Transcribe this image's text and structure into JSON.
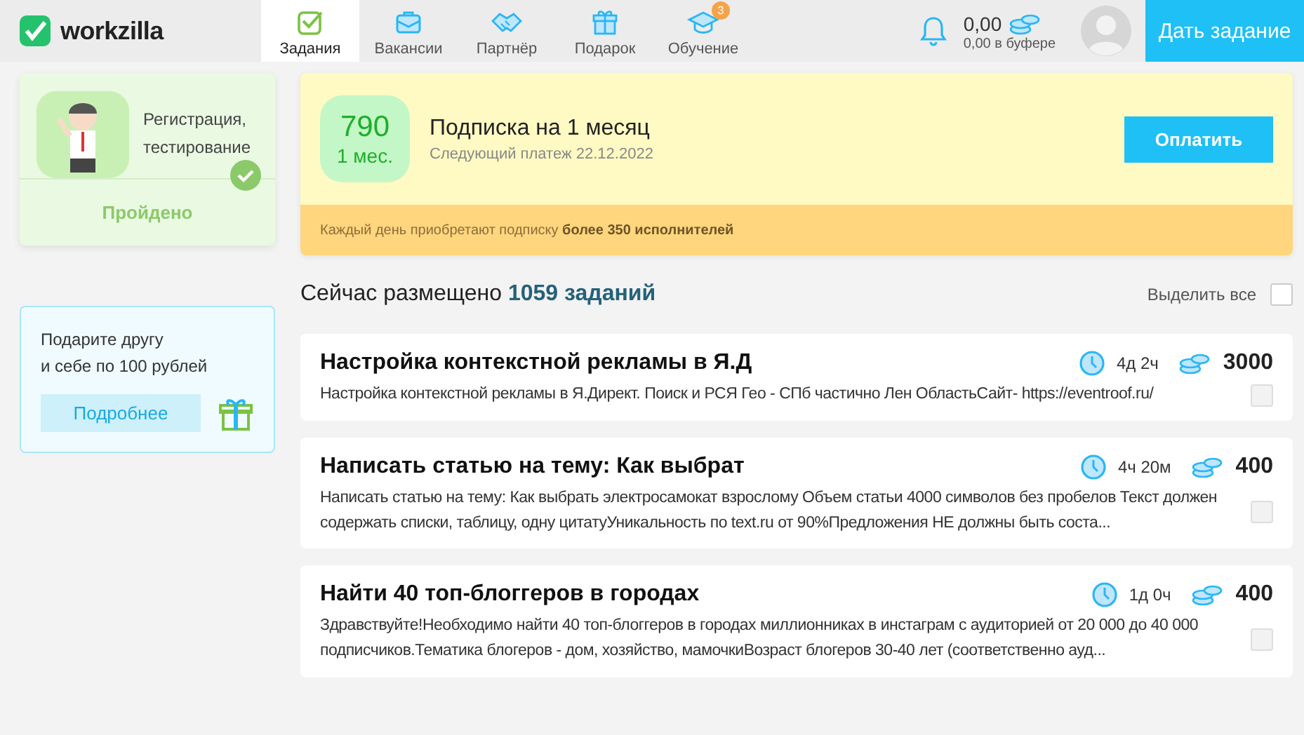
{
  "header": {
    "logo": "workzilla",
    "nav": [
      {
        "label": "Задания",
        "selected": true
      },
      {
        "label": "Вакансии",
        "selected": false
      },
      {
        "label": "Партнёр",
        "selected": false
      },
      {
        "label": "Подарок",
        "selected": false
      },
      {
        "label": "Обучение",
        "selected": false,
        "badge": "3"
      }
    ],
    "balance": "0,00",
    "buffer": "0,00 в буфере",
    "post_button": "Дать задание"
  },
  "sidebar": {
    "onboarding": {
      "text": "Регистрация,\nтестирование",
      "status": "Пройдено",
      "passed": true
    },
    "referral": {
      "text": "Подарите другу\nи себе по 100 рублей",
      "button": "Подробнее"
    }
  },
  "subscription": {
    "price": "790",
    "period": "1 мес.",
    "title": "Подписка на 1 месяц",
    "next_payment": "Следующий платеж 22.12.2022",
    "button": "Оплатить",
    "note": "Каждый день приобретают подписку **более 350 исполнителей**"
  },
  "listing": {
    "heading": "Сейчас размещено **1059 заданий**",
    "select_all": {
      "label": "Выделить все",
      "checked": false
    }
  },
  "tasks": [
    {
      "title": "Настройка контекстной рекламы в Я.Д",
      "time": "4д 2ч",
      "price": "3000",
      "description": "Настройка контекстной рекламы в Я.Директ. Поиск и РСЯ Гео - СПб частично Лен ОбластьСайт- https://eventroof.ru/",
      "selected": false
    },
    {
      "title": "Написать статью на тему: Как выбрат",
      "time": "4ч 20м",
      "price": "400",
      "description": "Написать статью на тему: Как выбрать электросамокат взрослому Объем статьи 4000 символов без пробелов Текст должен содержать списки, таблицу, одну цитатуУникальность по text.ru от 90%Предложения НЕ должны быть соста...",
      "selected": false
    },
    {
      "title": "Найти 40 топ-блоггеров в городах",
      "time": "1д 0ч",
      "price": "400",
      "description": "Здравствуйте!Необходимо найти 40 топ-блоггеров в городах миллионниках в инстаграм с аудиторией от 20 000 до 40 000 подписчиков.Тематика блогеров - дом, хозяйство, мамочкиВозраст блогеров 30-40 лет (соответственно ауд...",
      "selected": false
    }
  ]
}
